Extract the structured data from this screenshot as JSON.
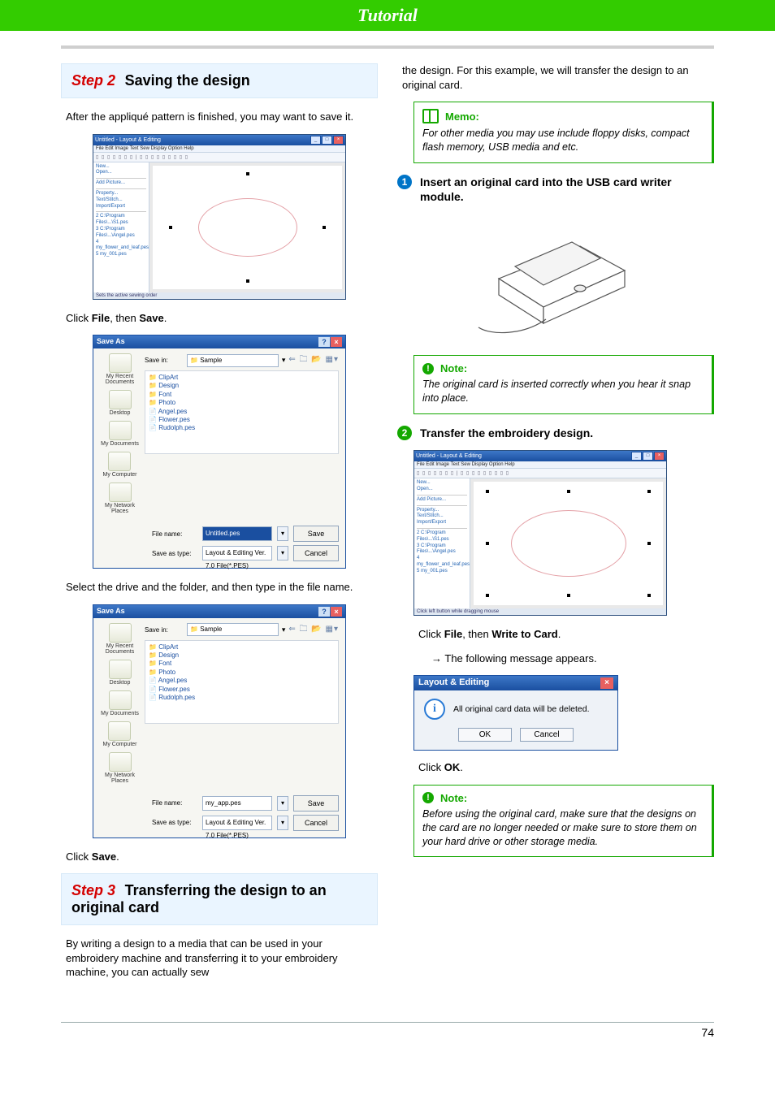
{
  "header": {
    "title": "Tutorial"
  },
  "left": {
    "step2": {
      "step": "Step 2",
      "title": "Saving the design"
    },
    "intro": "After the appliqué pattern is finished, you may want to save it.",
    "clickFileSave_pre": "Click ",
    "clickFileSave_file": "File",
    "clickFileSave_mid": ", then ",
    "clickFileSave_save": "Save",
    "clickFileSave_post": ".",
    "selectDrive": "Select the drive and the folder, and then type in the file name.",
    "clickSave_pre": "Click ",
    "clickSave_bold": "Save",
    "clickSave_post": ".",
    "step3": {
      "step": "Step 3",
      "title": "Transferring the design to an original card"
    },
    "step3body": "By writing a design to a media that can be used in your embroidery machine and transferring it to your embroidery machine, you can actually sew"
  },
  "right": {
    "continuation": "the design. For this example, we will transfer the design to an original card.",
    "memo": {
      "title": "Memo:",
      "body": "For other media you may use include floppy disks, compact flash memory, USB media and etc."
    },
    "step1": "Insert an original card into the USB card writer module.",
    "note1": {
      "title": "Note:",
      "body": "The original card is inserted correctly when you hear it snap into place."
    },
    "step2": "Transfer the embroidery design.",
    "clickWrite_pre": "Click ",
    "clickWrite_file": "File",
    "clickWrite_mid": ", then ",
    "clickWrite_write": "Write to Card",
    "clickWrite_post": ".",
    "following": "The following message appears.",
    "msgbox": {
      "title": "Layout & Editing",
      "msg": "All original card data will be deleted.",
      "ok": "OK",
      "cancel": "Cancel"
    },
    "clickOK_pre": "Click ",
    "clickOK_bold": "OK",
    "clickOK_post": ".",
    "note2": {
      "title": "Note:",
      "body": "Before using the original card, make sure that the designs on the card are no longer needed or make sure to store them on your hard drive or other storage media."
    }
  },
  "app": {
    "title": "Untitled - Layout & Editing",
    "menu": "File  Edit  Image  Text  Sew  Display  Option  Help",
    "side": {
      "new": "New...",
      "open": "Open...",
      "addpic": "Add Picture...",
      "prop": "Property...",
      "text": "Text/Stitch...",
      "impul": "Import/Export",
      "two": "2 C:\\Program Files\\...\\S1.pes",
      "three": "3 C:\\Program Files\\...\\Angel.pes",
      "four": "4 my_flower_and_leaf.pes",
      "five": "5 my_001.pes"
    },
    "status": "Sets the active sewing order"
  },
  "saveas": {
    "title": "Save As",
    "savein_label": "Save in:",
    "savein_value": "Sample",
    "folders": [
      "ClipArt",
      "Design",
      "Font",
      "Photo"
    ],
    "files": [
      "Angel.pes",
      "Flower.pes",
      "Rudolph.pes"
    ],
    "side": [
      "My Recent Documents",
      "Desktop",
      "My Documents",
      "My Computer",
      "My Network Places"
    ],
    "filename_label": "File name:",
    "filename1": "Untitled.pes",
    "filename2": "my_app.pes",
    "savetype_label": "Save as type:",
    "savetype_value": "Layout & Editing Ver. 7.0 File(*.PES)",
    "save_btn": "Save",
    "cancel_btn": "Cancel"
  },
  "pagenum": "74"
}
